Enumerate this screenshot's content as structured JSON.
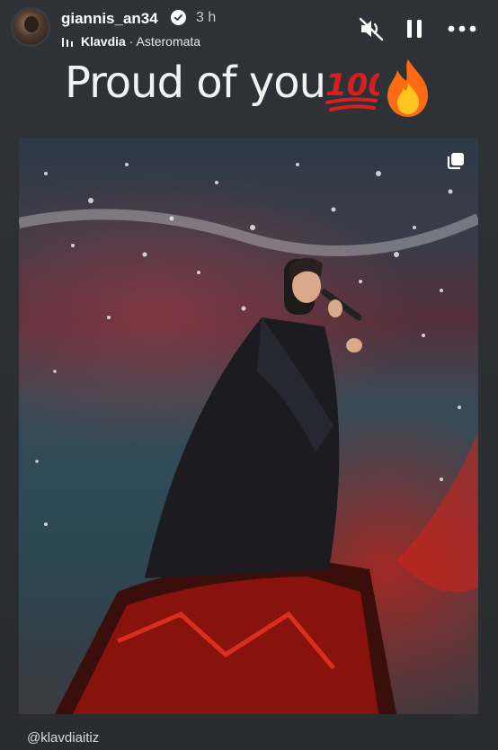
{
  "header": {
    "username": "giannis_an34",
    "time": "3 h",
    "music": {
      "artist": "Klavdia",
      "separator": " · ",
      "song": "Asteromata"
    },
    "icons": [
      "avatar",
      "verified-badge-icon",
      "music-bars-icon",
      "mute-icon",
      "pause-icon",
      "more-options-icon"
    ]
  },
  "story": {
    "caption": "Proud of you",
    "caption_emojis": [
      "hundred-points-icon",
      "fire-icon"
    ],
    "photo_icon": "multiple-photos-icon"
  },
  "footer": {
    "mention": "@klavdiaitiz"
  },
  "colors": {
    "background": "#2f3337",
    "accent_red": "#d61f1f",
    "fire_orange": "#ff7a1a"
  }
}
